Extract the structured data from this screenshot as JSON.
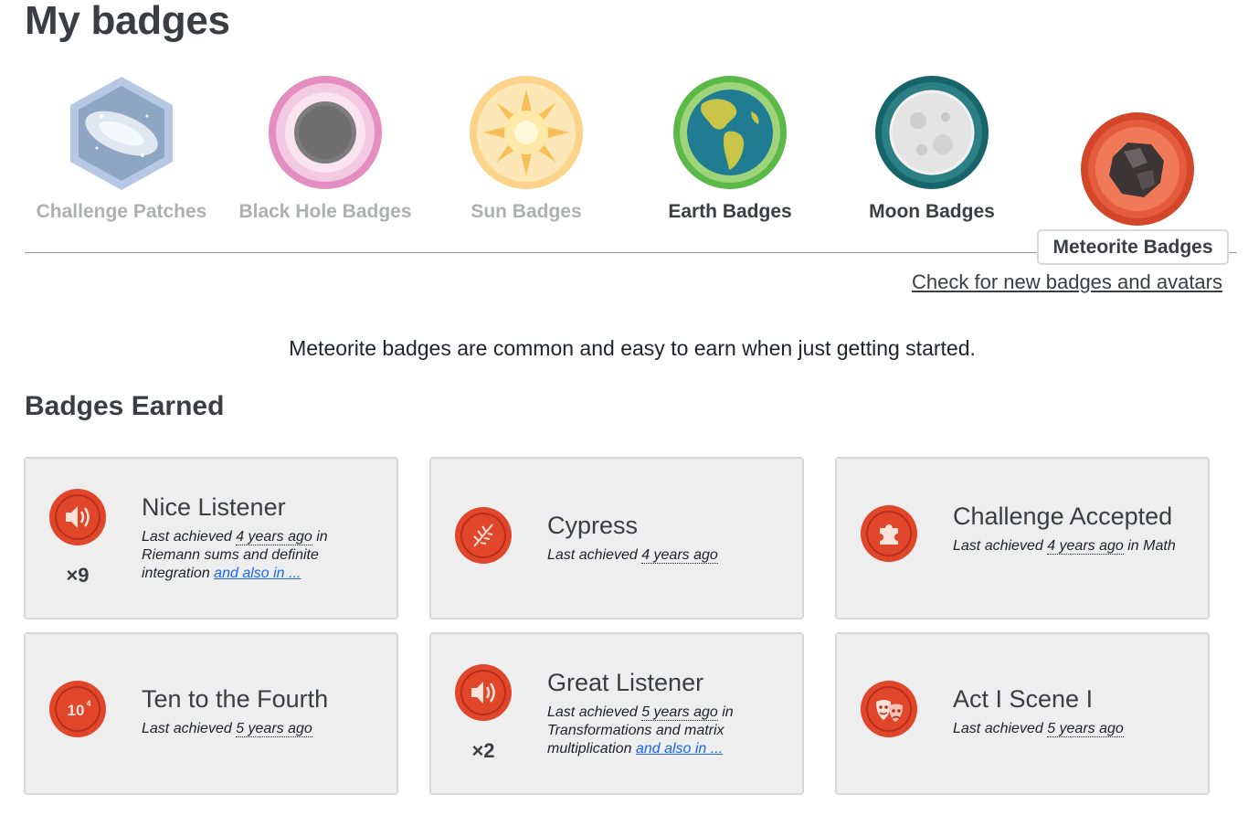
{
  "page_title": "My badges",
  "categories": [
    {
      "label": "Challenge Patches",
      "state": "locked"
    },
    {
      "label": "Black Hole Badges",
      "state": "locked"
    },
    {
      "label": "Sun Badges",
      "state": "locked"
    },
    {
      "label": "Earth Badges",
      "state": "available"
    },
    {
      "label": "Moon Badges",
      "state": "available"
    },
    {
      "label": "Meteorite Badges",
      "state": "selected"
    }
  ],
  "check_link": "Check for new badges and avatars",
  "description": "Meteorite badges are common and easy to earn when just getting started.",
  "section_heading": "Badges Earned",
  "badges": [
    {
      "icon": "speaker-icon",
      "name": "Nice Listener",
      "count": "×9",
      "prefix": "Last achieved",
      "ago": "4 years ago",
      "in": "in",
      "context": "Riemann sums and definite integration",
      "also": "and also in ..."
    },
    {
      "icon": "leaf-icon",
      "name": "Cypress",
      "count": "",
      "prefix": "Last achieved",
      "ago": "4 years ago",
      "in": "",
      "context": "",
      "also": ""
    },
    {
      "icon": "puzzle-icon",
      "name": "Challenge Accepted",
      "count": "",
      "prefix": "Last achieved",
      "ago": "4 years ago",
      "in": "in",
      "context": "Math",
      "also": ""
    },
    {
      "icon": "ten-to-fourth-icon",
      "name": "Ten to the Fourth",
      "count": "",
      "prefix": "Last achieved",
      "ago": "5 years ago",
      "in": "",
      "context": "",
      "also": ""
    },
    {
      "icon": "speaker-icon",
      "name": "Great Listener",
      "count": "×2",
      "prefix": "Last achieved",
      "ago": "5 years ago",
      "in": "in",
      "context": "Transformations and matrix multiplication",
      "also": "and also in ..."
    },
    {
      "icon": "theater-masks-icon",
      "name": "Act I Scene I",
      "count": "",
      "prefix": "Last achieved",
      "ago": "5 years ago",
      "in": "",
      "context": "",
      "also": ""
    }
  ],
  "colors": {
    "badge_red": "#e1462a",
    "badge_dark_red": "#b92d1b",
    "card_bg": "#eeeeee",
    "link_blue": "#1865f2"
  }
}
